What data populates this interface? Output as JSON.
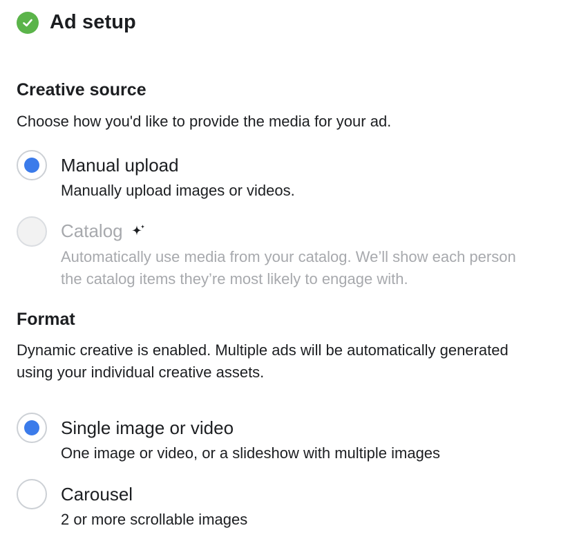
{
  "header": {
    "title": "Ad setup",
    "status_icon": "check-circle-icon",
    "status_color": "#5bb44a"
  },
  "creative_source": {
    "title": "Creative source",
    "description": "Choose how you'd like to provide the media for your ad.",
    "options": [
      {
        "label": "Manual upload",
        "sublabel": "Manually upload images or videos.",
        "selected": true,
        "disabled": false
      },
      {
        "label": "Catalog",
        "sublabel_line1": "Automatically use media from your catalog. We’ll show each person",
        "sublabel_line2": "the catalog items they’re most likely to engage with.",
        "icon": "sparkle-icon",
        "selected": false,
        "disabled": true
      }
    ]
  },
  "format": {
    "title": "Format",
    "description_line1": "Dynamic creative is enabled. Multiple ads will be automatically generated",
    "description_line2": "using your individual creative assets.",
    "options": [
      {
        "label": "Single image or video",
        "sublabel": "One image or video, or a slideshow with multiple images",
        "selected": true
      },
      {
        "label": "Carousel",
        "sublabel": "2 or more scrollable images",
        "selected": false
      }
    ]
  },
  "colors": {
    "accent": "#3b7bea",
    "text": "#1c1e21",
    "disabled_text": "#a7a9ad",
    "radio_border": "#ccd0d5"
  }
}
